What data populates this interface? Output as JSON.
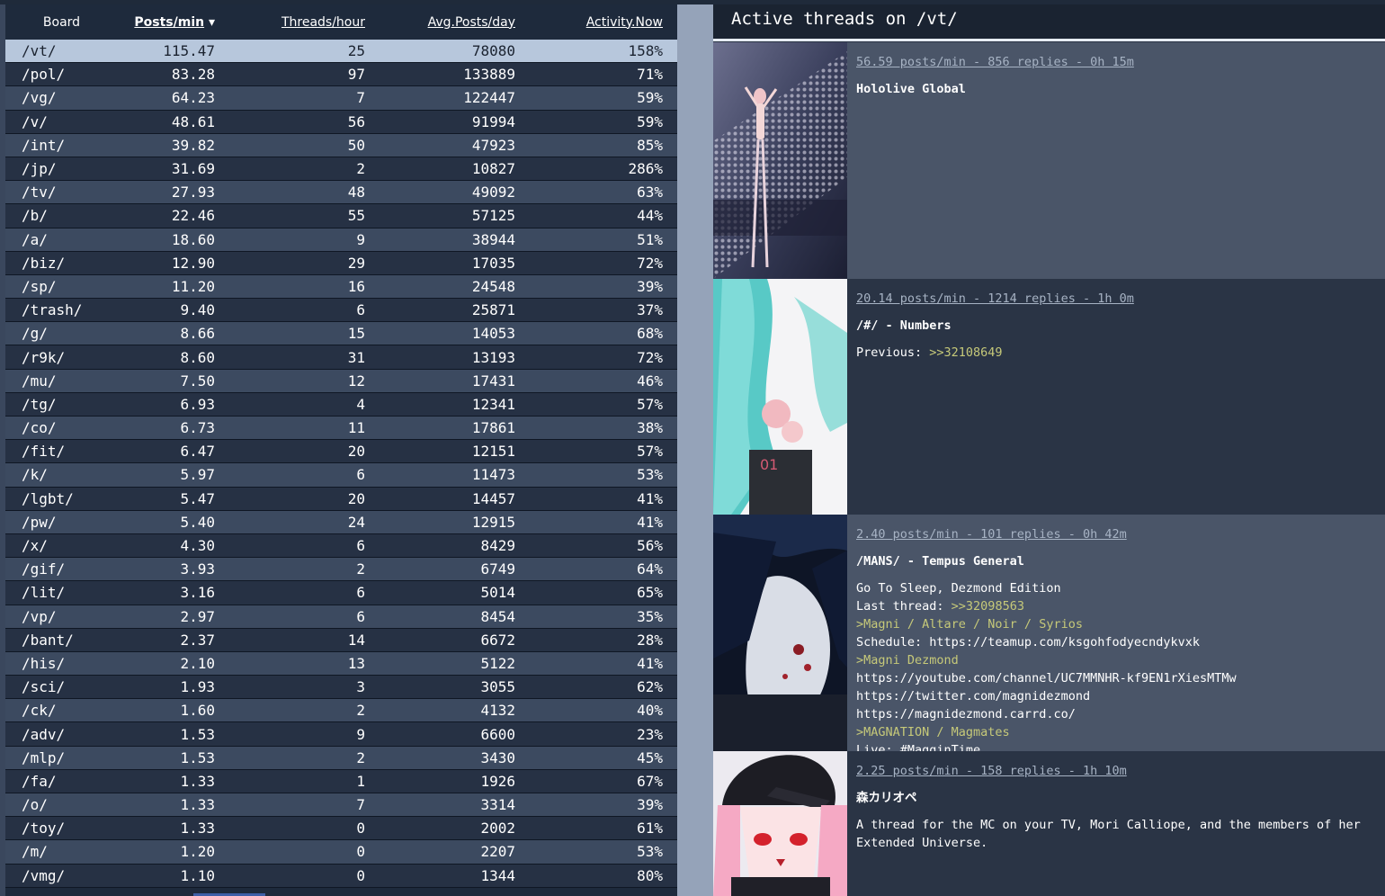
{
  "table": {
    "headers": {
      "board": "Board",
      "posts_per_min": "Posts/min",
      "sort_indicator": "▾",
      "threads_per_hour": "Threads/hour",
      "avg_posts_day": "Avg.Posts/day",
      "activity_now": "Activity.Now"
    },
    "rows": [
      {
        "board": "/vt/",
        "ppm": "115.47",
        "tph": "25",
        "apd": "78080",
        "act": "158%"
      },
      {
        "board": "/pol/",
        "ppm": "83.28",
        "tph": "97",
        "apd": "133889",
        "act": "71%"
      },
      {
        "board": "/vg/",
        "ppm": "64.23",
        "tph": "7",
        "apd": "122447",
        "act": "59%"
      },
      {
        "board": "/v/",
        "ppm": "48.61",
        "tph": "56",
        "apd": "91994",
        "act": "59%"
      },
      {
        "board": "/int/",
        "ppm": "39.82",
        "tph": "50",
        "apd": "47923",
        "act": "85%"
      },
      {
        "board": "/jp/",
        "ppm": "31.69",
        "tph": "2",
        "apd": "10827",
        "act": "286%"
      },
      {
        "board": "/tv/",
        "ppm": "27.93",
        "tph": "48",
        "apd": "49092",
        "act": "63%"
      },
      {
        "board": "/b/",
        "ppm": "22.46",
        "tph": "55",
        "apd": "57125",
        "act": "44%"
      },
      {
        "board": "/a/",
        "ppm": "18.60",
        "tph": "9",
        "apd": "38944",
        "act": "51%"
      },
      {
        "board": "/biz/",
        "ppm": "12.90",
        "tph": "29",
        "apd": "17035",
        "act": "72%"
      },
      {
        "board": "/sp/",
        "ppm": "11.20",
        "tph": "16",
        "apd": "24548",
        "act": "39%"
      },
      {
        "board": "/trash/",
        "ppm": "9.40",
        "tph": "6",
        "apd": "25871",
        "act": "37%"
      },
      {
        "board": "/g/",
        "ppm": "8.66",
        "tph": "15",
        "apd": "14053",
        "act": "68%"
      },
      {
        "board": "/r9k/",
        "ppm": "8.60",
        "tph": "31",
        "apd": "13193",
        "act": "72%"
      },
      {
        "board": "/mu/",
        "ppm": "7.50",
        "tph": "12",
        "apd": "17431",
        "act": "46%"
      },
      {
        "board": "/tg/",
        "ppm": "6.93",
        "tph": "4",
        "apd": "12341",
        "act": "57%"
      },
      {
        "board": "/co/",
        "ppm": "6.73",
        "tph": "11",
        "apd": "17861",
        "act": "38%"
      },
      {
        "board": "/fit/",
        "ppm": "6.47",
        "tph": "20",
        "apd": "12151",
        "act": "57%"
      },
      {
        "board": "/k/",
        "ppm": "5.97",
        "tph": "6",
        "apd": "11473",
        "act": "53%"
      },
      {
        "board": "/lgbt/",
        "ppm": "5.47",
        "tph": "20",
        "apd": "14457",
        "act": "41%"
      },
      {
        "board": "/pw/",
        "ppm": "5.40",
        "tph": "24",
        "apd": "12915",
        "act": "41%"
      },
      {
        "board": "/x/",
        "ppm": "4.30",
        "tph": "6",
        "apd": "8429",
        "act": "56%"
      },
      {
        "board": "/gif/",
        "ppm": "3.93",
        "tph": "2",
        "apd": "6749",
        "act": "64%"
      },
      {
        "board": "/lit/",
        "ppm": "3.16",
        "tph": "6",
        "apd": "5014",
        "act": "65%"
      },
      {
        "board": "/vp/",
        "ppm": "2.97",
        "tph": "6",
        "apd": "8454",
        "act": "35%"
      },
      {
        "board": "/bant/",
        "ppm": "2.37",
        "tph": "14",
        "apd": "6672",
        "act": "28%"
      },
      {
        "board": "/his/",
        "ppm": "2.10",
        "tph": "13",
        "apd": "5122",
        "act": "41%"
      },
      {
        "board": "/sci/",
        "ppm": "1.93",
        "tph": "3",
        "apd": "3055",
        "act": "62%"
      },
      {
        "board": "/ck/",
        "ppm": "1.60",
        "tph": "2",
        "apd": "4132",
        "act": "40%"
      },
      {
        "board": "/adv/",
        "ppm": "1.53",
        "tph": "9",
        "apd": "6600",
        "act": "23%"
      },
      {
        "board": "/mlp/",
        "ppm": "1.53",
        "tph": "2",
        "apd": "3430",
        "act": "45%"
      },
      {
        "board": "/fa/",
        "ppm": "1.33",
        "tph": "1",
        "apd": "1926",
        "act": "67%"
      },
      {
        "board": "/o/",
        "ppm": "1.33",
        "tph": "7",
        "apd": "3314",
        "act": "39%"
      },
      {
        "board": "/toy/",
        "ppm": "1.33",
        "tph": "0",
        "apd": "2002",
        "act": "61%"
      },
      {
        "board": "/m/",
        "ppm": "1.20",
        "tph": "0",
        "apd": "2207",
        "act": "53%"
      },
      {
        "board": "/vmg/",
        "ppm": "1.10",
        "tph": "0",
        "apd": "1344",
        "act": "80%"
      }
    ]
  },
  "threads_panel": {
    "title": "Active threads on /vt/",
    "threads": [
      {
        "stats": "56.59 posts/min - 856 replies - 0h 15m",
        "title": "Hololive Global",
        "body": []
      },
      {
        "stats": "20.14 posts/min - 1214 replies - 1h 0m",
        "title": "/#/ - Numbers",
        "body": [
          {
            "plain": "Previous: ",
            "quote": ">>32108649"
          }
        ]
      },
      {
        "stats": "2.40 posts/min - 101 replies - 0h 42m",
        "title": "/MANS/ - Tempus General",
        "body": [
          {
            "plain": "Go To Sleep, Dezmond Edition",
            "quote": ""
          },
          {
            "plain": "Last thread: ",
            "quote": ">>32098563"
          },
          {
            "plain": "",
            "quote": ">Magni / Altare / Noir / Syrios"
          },
          {
            "plain": "Schedule: https://teamup.com/ksgohfodyecndykvxk",
            "quote": ""
          },
          {
            "plain": "",
            "quote": ">Magni Dezmond"
          },
          {
            "plain": "https://youtube.com/channel/UC7MMNHR-kf9EN1rXiesMTMw",
            "quote": ""
          },
          {
            "plain": "https://twitter.com/magnidezmond",
            "quote": ""
          },
          {
            "plain": "https://magnidezmond.carrd.co/",
            "quote": ""
          },
          {
            "plain": "",
            "quote": ">MAGNATION / Magmates"
          },
          {
            "plain": "Live: #MagginTime",
            "quote": ""
          }
        ]
      },
      {
        "stats": "2.25 posts/min - 158 replies - 1h 10m",
        "title": "森カリオペ",
        "description": "A thread for the MC on your TV, Mori Calliope, and the members of her Extended Universe."
      }
    ]
  },
  "icons": {
    "sort": "sort-desc-icon"
  }
}
